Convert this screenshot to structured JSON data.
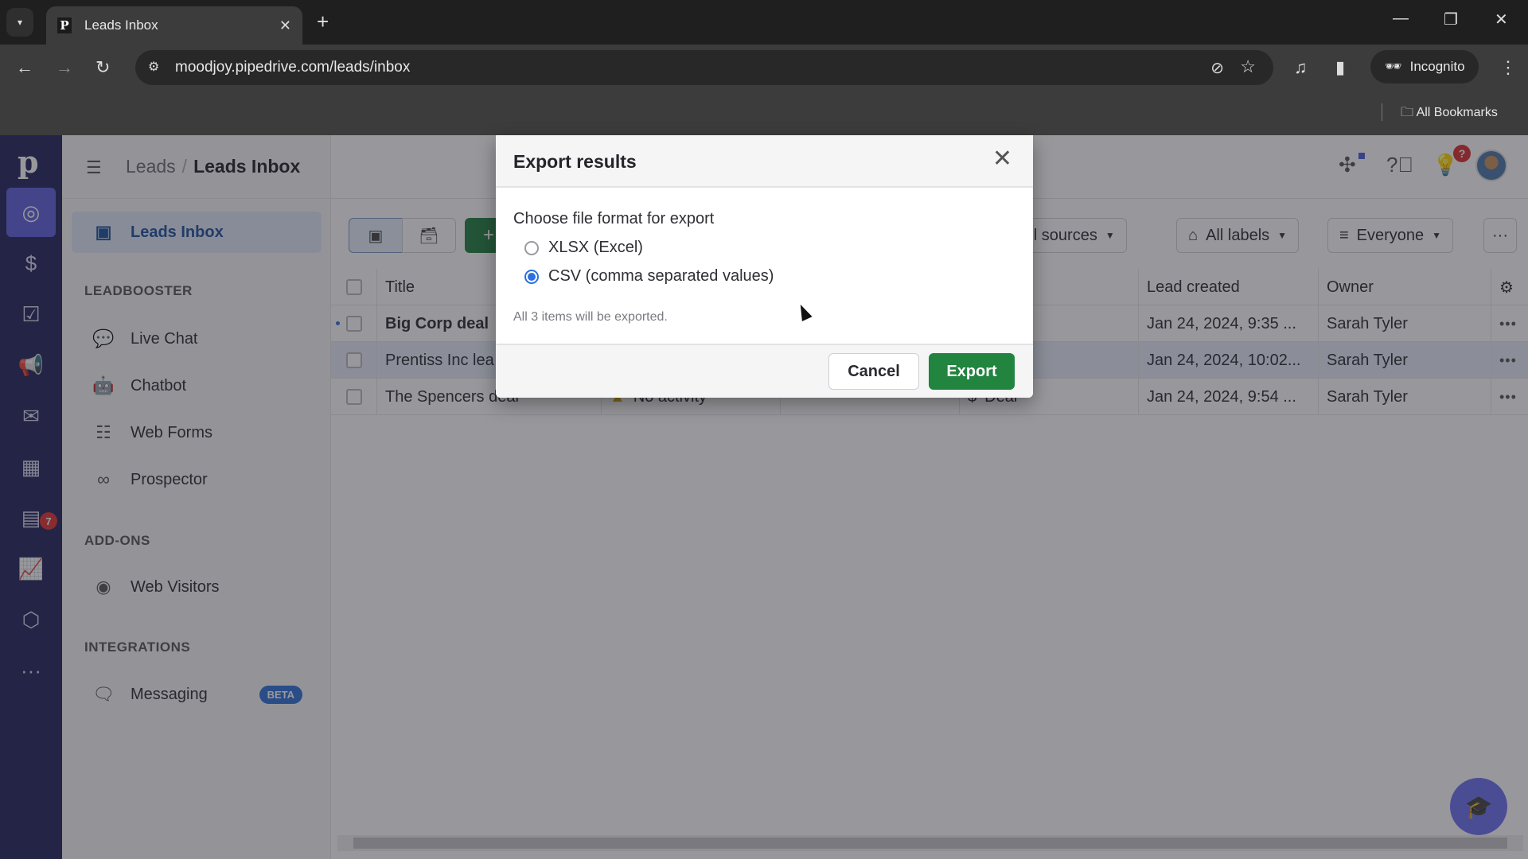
{
  "browser": {
    "tab_title": "Leads Inbox",
    "favicon_letter": "P",
    "url": "moodjoy.pipedrive.com/leads/inbox",
    "incognito_label": "Incognito",
    "all_bookmarks_label": "All Bookmarks"
  },
  "rail": {
    "logo": "p",
    "items": [
      {
        "name": "leads",
        "icon": "target-icon",
        "active": true
      },
      {
        "name": "deals",
        "icon": "dollar-icon"
      },
      {
        "name": "projects",
        "icon": "clipboard-check-icon"
      },
      {
        "name": "campaigns",
        "icon": "megaphone-icon"
      },
      {
        "name": "mail",
        "icon": "mail-icon"
      },
      {
        "name": "activities",
        "icon": "calendar-icon",
        "badge": "7"
      },
      {
        "name": "contacts",
        "icon": "contact-card-icon"
      },
      {
        "name": "insights",
        "icon": "chart-icon"
      },
      {
        "name": "products",
        "icon": "box-icon"
      },
      {
        "name": "more",
        "icon": "more-icon"
      }
    ]
  },
  "subnav": {
    "breadcrumb_root": "Leads",
    "breadcrumb_separator": "/",
    "breadcrumb_current": "Leads Inbox",
    "active_item": "Leads Inbox",
    "sections": [
      {
        "title": "LEADBOOSTER",
        "items": [
          "Live Chat",
          "Chatbot",
          "Web Forms",
          "Prospector"
        ]
      },
      {
        "title": "ADD-ONS",
        "items": [
          "Web Visitors"
        ]
      },
      {
        "title": "INTEGRATIONS",
        "items": [
          "Messaging"
        ]
      }
    ],
    "beta_badge": "BETA"
  },
  "topbar": {
    "notification_badge": "?"
  },
  "toolbar": {
    "add_label": "+",
    "filters": {
      "sources": "All sources",
      "labels": "All labels",
      "owner": "Everyone"
    },
    "more_label": "···"
  },
  "table": {
    "columns": {
      "title": "Title",
      "lead_created": "Lead created",
      "owner": "Owner"
    },
    "rows": [
      {
        "title": "Big Corp deal",
        "activity": "",
        "source": "",
        "lead_created": "Jan 24, 2024, 9:35 ...",
        "owner": "Sarah Tyler",
        "unread": true
      },
      {
        "title": "Prentiss Inc lea",
        "activity": "",
        "source": "",
        "lead_created": "Jan 24, 2024, 10:02...",
        "owner": "Sarah Tyler",
        "selected": true
      },
      {
        "title": "The Spencers deal",
        "activity": "No activity",
        "source": "Deal",
        "lead_created": "Jan 24, 2024, 9:54 ...",
        "owner": "Sarah Tyler"
      }
    ],
    "row_menu": "•••"
  },
  "modal": {
    "title": "Export results",
    "prompt": "Choose file format for export",
    "options": [
      {
        "label": "XLSX (Excel)",
        "checked": false
      },
      {
        "label": "CSV (comma separated values)",
        "checked": true
      }
    ],
    "note": "All 3 items will be exported.",
    "cancel_label": "Cancel",
    "export_label": "Export"
  },
  "colors": {
    "rail_bg": "#21225a",
    "rail_active": "#5c5edb",
    "primary_green": "#21843f",
    "radio_blue": "#2b6fe0",
    "beta_blue": "#2c6fd8"
  }
}
